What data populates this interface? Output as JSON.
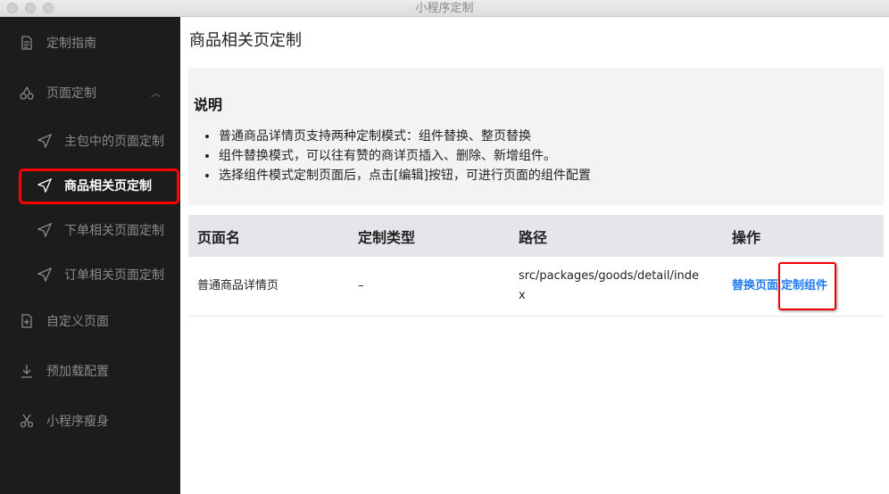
{
  "window": {
    "title": "小程序定制"
  },
  "sidebar": {
    "items": [
      {
        "label": "定制指南",
        "icon": "document-icon"
      },
      {
        "label": "页面定制",
        "icon": "cherry-icon"
      },
      {
        "label": "主包中的页面定制",
        "icon": "navigation-arrow-icon"
      },
      {
        "label": "商品相关页定制",
        "icon": "navigation-arrow-icon",
        "active": true
      },
      {
        "label": "下单相关页面定制",
        "icon": "navigation-arrow-icon"
      },
      {
        "label": "订单相关页面定制",
        "icon": "navigation-arrow-icon"
      },
      {
        "label": "自定义页面",
        "icon": "file-plus-icon"
      },
      {
        "label": "预加载配置",
        "icon": "download-icon"
      },
      {
        "label": "小程序瘦身",
        "icon": "scissors-icon"
      }
    ]
  },
  "main": {
    "title": "商品相关页定制",
    "info": {
      "heading": "说明",
      "points": [
        "普通商品详情页支持两种定制模式：组件替换、整页替换",
        "组件替换模式，可以往有赞的商详页插入、删除、新增组件。",
        "选择组件模式定制页面后，点击[编辑]按钮，可进行页面的组件配置"
      ]
    },
    "table": {
      "headers": [
        "页面名",
        "定制类型",
        "路径",
        "操作"
      ],
      "rows": [
        {
          "name": "普通商品详情页",
          "type": "–",
          "path": "src/packages/goods/detail/index",
          "actions": [
            "替换页面",
            "定制组件"
          ]
        }
      ]
    }
  }
}
